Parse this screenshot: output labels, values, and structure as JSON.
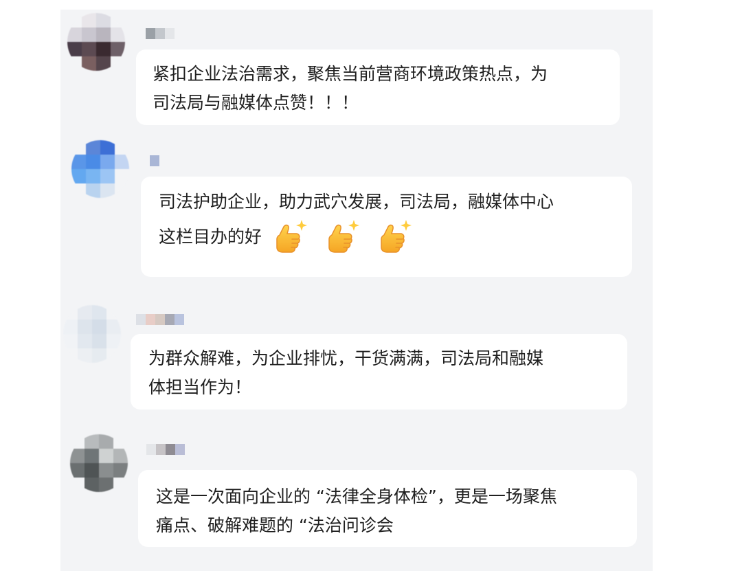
{
  "comments": [
    {
      "nickname": "",
      "text_lines": [
        "紧扣企业法治需求，聚焦当前营商环境政策热点，为",
        "司法局与融媒体点赞！！！"
      ],
      "avatar_colors": [
        "#f3f4f6",
        "#e9e6ea",
        "#dcdce3",
        "#f3f4f6",
        "#d8d5dc",
        "#c9c6cf",
        "#b9b5be",
        "#e4e3e8",
        "#4a3d49",
        "#5c4a52",
        "#3a2a30",
        "#6e6068",
        "#f3f4f6",
        "#7a5f60",
        "#55454c",
        "#f3f4f6"
      ],
      "nick_colors": [
        "#9aa0a6",
        "#c3c7cc",
        "#e4e6e9"
      ]
    },
    {
      "nickname": "",
      "text_lines": [
        "司法护助企业，助力武穴发展，司法局，融媒体中心",
        "这栏目办的好"
      ],
      "emoji": [
        "thumbs-up-sparkle-icon",
        "thumbs-up-sparkle-icon",
        "thumbs-up-sparkle-icon"
      ],
      "avatar_colors": [
        "#f3f4f6",
        "#5b86d8",
        "#3d6fd6",
        "#f3f4f6",
        "#5a96e8",
        "#4a8be6",
        "#7aa9ee",
        "#c3d5f2",
        "#63a8f0",
        "#79b5f2",
        "#9cc5f4",
        "#f3f4f6",
        "#f3f4f6",
        "#b9d3ef",
        "#dbe5f1",
        "#f3f4f6"
      ],
      "nick_colors": [
        "#a9b6d6"
      ]
    },
    {
      "nickname": "",
      "text_lines": [
        "为群众解难，为企业排忧，干货满满，司法局和融媒",
        "体担当作为！"
      ],
      "avatar_colors": [
        "#f3f4f6",
        "#e6eaf0",
        "#dfe6ee",
        "#f3f4f6",
        "#eef1f5",
        "#dde4ec",
        "#d4dde8",
        "#e9edf2",
        "#f1f3f6",
        "#e2e8ef",
        "#d9e1ea",
        "#eef1f5",
        "#f3f4f6",
        "#eceff3",
        "#e6ebf0",
        "#f3f4f6"
      ],
      "nick_colors": [
        "#dde0e6",
        "#e8cdc7",
        "#d6c9c2",
        "#a7a9b4",
        "#b9c3de"
      ]
    },
    {
      "nickname": "",
      "text_lines": [
        "这是一次面向企业的 “法律全身体检”，更是一场聚焦",
        "痛点、破解难题的 “法治问诊会"
      ],
      "avatar_colors": [
        "#f3f4f6",
        "#b8bbbd",
        "#a8abad",
        "#f3f4f6",
        "#8e9293",
        "#6f7577",
        "#cfd2d2",
        "#b3b6b7",
        "#6a6f70",
        "#4f5455",
        "#8a8e8f",
        "#7b7f80",
        "#f3f4f6",
        "#5d6263",
        "#6c7071",
        "#f3f4f6"
      ],
      "nick_colors": [
        "#e4e6e9",
        "#c6c3c6",
        "#8f8c93",
        "#b9bdd6"
      ]
    }
  ]
}
